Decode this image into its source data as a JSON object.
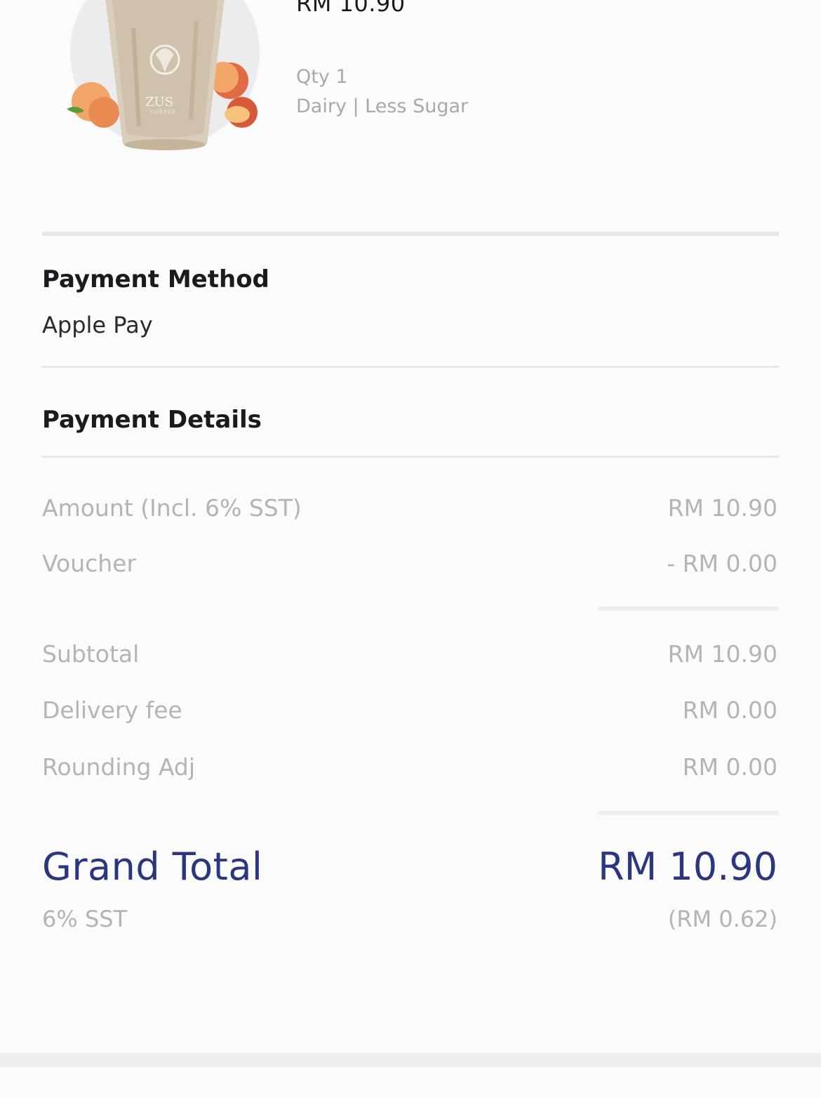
{
  "product": {
    "image_icon": "iced-peach-latte-drink-image",
    "brand_text": "ZUS",
    "brand_subtext": "COFFEE",
    "price": "RM 10.90",
    "qty": "Qty 1",
    "options": "Dairy | Less Sugar"
  },
  "payment_method": {
    "title": "Payment Method",
    "value": "Apple Pay"
  },
  "payment_details": {
    "title": "Payment Details",
    "rows": [
      {
        "label": "Amount (Incl. 6% SST)",
        "value": "RM 10.90"
      },
      {
        "label": "Voucher",
        "value": "- RM 0.00"
      },
      {
        "label": "Subtotal",
        "value": "RM 10.90"
      },
      {
        "label": "Delivery fee",
        "value": "RM 0.00"
      },
      {
        "label": "Rounding Adj",
        "value": "RM 0.00"
      }
    ],
    "grand_total_label": "Grand Total",
    "grand_total_value": "RM 10.90",
    "sst_label": "6% SST",
    "sst_value": "(RM 0.62)"
  },
  "colors": {
    "accent": "#2b3680",
    "muted": "#b4b4b8",
    "divider": "#e7e7ea"
  }
}
